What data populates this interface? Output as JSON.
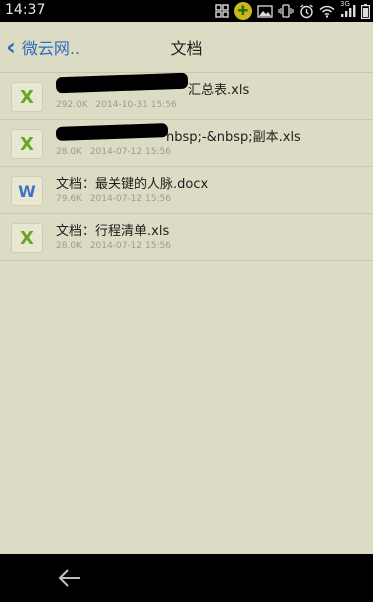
{
  "status_bar": {
    "time": "14:37",
    "icons": [
      "grid-icon",
      "green-app-icon",
      "image-icon",
      "vibrate-icon",
      "alarm-icon",
      "wifi-icon",
      "signal-3g-icon",
      "battery-icon"
    ],
    "network": "3G"
  },
  "nav": {
    "back_label": "微云网..",
    "title": "文档",
    "accent_color": "#2d6cc0"
  },
  "files": [
    {
      "type": "xls",
      "icon_glyph": "X",
      "name": "汇总表.xls",
      "size": "292.0K",
      "date": "2014-10-31 15:56"
    },
    {
      "type": "xls",
      "icon_glyph": "X",
      "name": "nbsp;-&nbsp;副本.xls",
      "size": "28.0K",
      "date": "2014-07-12 15:56"
    },
    {
      "type": "doc",
      "icon_glyph": "W",
      "name": "文档：最关键的人脉.docx",
      "size": "79.6K",
      "date": "2014-07-12 15:56"
    },
    {
      "type": "xls",
      "icon_glyph": "X",
      "name": "文档：行程清单.xls",
      "size": "28.0K",
      "date": "2014-07-12 15:56"
    }
  ],
  "colors": {
    "background": "#dcdbc3",
    "xls_icon": "#6aa52b",
    "doc_icon": "#3f73c9"
  }
}
